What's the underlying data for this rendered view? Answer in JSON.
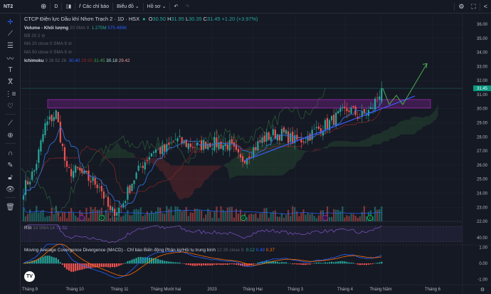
{
  "toolbar": {
    "symbol": "NT2",
    "interval": "D",
    "indicators": "Các chỉ báo",
    "chart_type": "Biểu đồ",
    "profile": "Hồ sơ"
  },
  "legend": {
    "title": "CTCP Điện lực Dầu khí Nhơn Trạch 2 · 1D · HSX",
    "ohlc": {
      "o_label": "O",
      "o": "30.50",
      "h_label": "H",
      "h": "31.95",
      "l_label": "L",
      "l": "30.35",
      "c_label": "C",
      "c": "31.45",
      "change": "+1.20 (+3.97%)"
    },
    "volume": {
      "name": "Volume - Khối lượng",
      "params": "20 SMA 9",
      "v1": "1.275M",
      "v2": "575.495K"
    },
    "bb": {
      "name": "BB 20 2"
    },
    "ma20": {
      "name": "MA 20 close 0 SMA 9"
    },
    "ma50": {
      "name": "MA 50 close 0 SMA 9"
    },
    "ichimoku": {
      "name": "Ichimoku",
      "params": "9 26 52 26",
      "v1": "30.40",
      "v2": "29.95",
      "v3": "31.45",
      "v4": "30.18",
      "v5": "29.42"
    },
    "rsi": {
      "name": "RSI",
      "params": "14 SMA 14",
      "value": "71.52"
    },
    "macd": {
      "name": "Moving Average Covergence Divergence (MACD) - Chỉ báo Biến động Phân kỳ/Hội tụ trung bình",
      "params": "12 26 close 9",
      "v1": "0.12",
      "v2": "0.49",
      "v3": "0.37"
    }
  },
  "price_axis": {
    "ticks": [
      "36.00",
      "35.00",
      "34.00",
      "33.00",
      "32.00",
      "31.00",
      "30.00",
      "29.00",
      "28.00",
      "27.00",
      "26.00",
      "25.00",
      "24.00",
      "23.00",
      "22.00"
    ],
    "last_price": "31.45"
  },
  "rsi_axis": {
    "ticks": [
      "40.00"
    ]
  },
  "macd_axis": {
    "ticks": [
      "1.00",
      "0.00",
      "-1.00"
    ]
  },
  "time_axis": {
    "ticks": [
      "Tháng 9",
      "Tháng 10",
      "Tháng 11",
      "Tháng Mười hai",
      "2023",
      "Tháng Hai",
      "Tháng 3",
      "Tháng 4",
      "Tháng Năm",
      "Tháng 6"
    ]
  },
  "markers": [
    "D",
    "F",
    "F",
    "D",
    "F"
  ],
  "colors": {
    "up": "#26a69a",
    "down": "#ef5350",
    "background": "#151924",
    "zone": "#9c27b0",
    "trendline": "#3d5afe",
    "projection": "#4caf50",
    "rsi": "#7e57c2"
  },
  "chart_data": {
    "type": "candlestick",
    "ylim": [
      22,
      36
    ],
    "price_path": [
      24.3,
      25.6,
      28.8,
      29.7,
      25.5,
      25.6,
      25.0,
      24.6,
      22.6,
      23.0,
      24.8,
      26.1,
      27.1,
      27.0,
      27.8,
      27.5,
      27.3,
      27.6,
      27.5,
      27.4,
      26.3,
      27.0,
      27.8,
      28.2,
      28.2,
      27.7,
      27.9,
      28.5,
      28.9,
      29.5,
      30.0,
      29.4,
      29.9,
      31.45
    ],
    "resistance_zone": [
      30.05,
      30.65
    ],
    "trendline": [
      26.3,
      30.9
    ],
    "projection": [
      31.45,
      30.3,
      30.95,
      30.3,
      33.2
    ]
  }
}
